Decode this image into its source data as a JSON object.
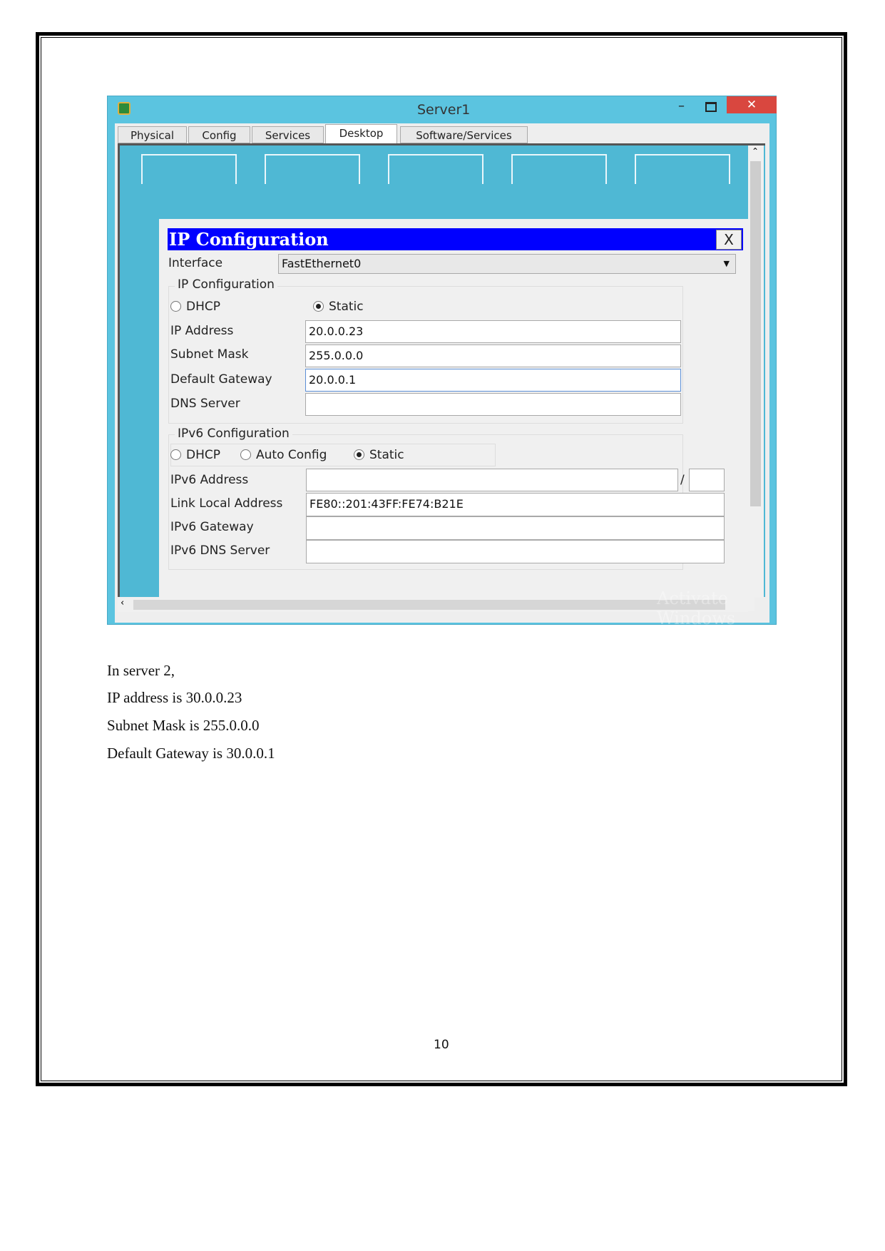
{
  "window": {
    "title": "Server1",
    "tabs": [
      "Physical",
      "Config",
      "Services",
      "Desktop",
      "Software/Services"
    ],
    "active_tab": "Desktop",
    "watermark": "Activate Windows"
  },
  "dialog": {
    "title": "IP Configuration",
    "close_label": "X",
    "interface_label": "Interface",
    "interface_value": "FastEthernet0",
    "ipv4": {
      "group_label": "IP Configuration",
      "dhcp_label": "DHCP",
      "static_label": "Static",
      "mode": "Static",
      "ip_label": "IP Address",
      "ip_value": "20.0.0.23",
      "mask_label": "Subnet Mask",
      "mask_value": "255.0.0.0",
      "gw_label": "Default Gateway",
      "gw_value": "20.0.0.1",
      "dns_label": "DNS Server",
      "dns_value": ""
    },
    "ipv6": {
      "group_label": "IPv6 Configuration",
      "dhcp_label": "DHCP",
      "auto_label": "Auto Config",
      "static_label": "Static",
      "mode": "Static",
      "addr_label": "IPv6 Address",
      "addr_value": "",
      "slash": "/",
      "prefix_value": "",
      "lla_label": "Link Local Address",
      "lla_value": "FE80::201:43FF:FE74:B21E",
      "gw_label": "IPv6 Gateway",
      "gw_value": "",
      "dns_label": "IPv6 DNS Server",
      "dns_value": ""
    }
  },
  "body": {
    "lines": [
      "In server 2,",
      "IP address is 30.0.0.23",
      "Subnet Mask is 255.0.0.0",
      "Default Gateway is 30.0.0.1"
    ],
    "page_number": "10"
  },
  "colors": {
    "titlebar": "#5bc4e0",
    "dialog_title": "#0000ff",
    "close": "#d9473f"
  }
}
